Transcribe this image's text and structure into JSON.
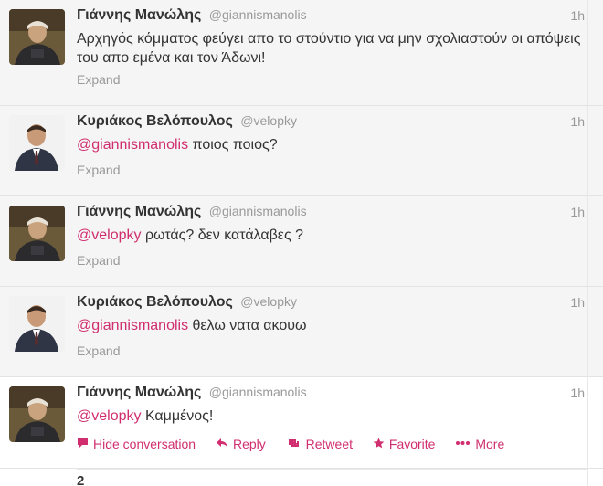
{
  "tweets": [
    {
      "fullname": "Γιάννης Μανώλης",
      "username": "@giannismanolis",
      "time": "1h",
      "text": "Αρχηγός κόμματος φεύγει απο το στούντιο για να μην σχολιαστούν οι απόψεις του απο εμένα και τον Άδωνι!",
      "expand": "Expand"
    },
    {
      "fullname": "Κυριάκος Βελόπουλος",
      "username": "@velopky",
      "time": "1h",
      "mention": "@giannismanolis",
      "text": " ποιος ποιος?",
      "expand": "Expand"
    },
    {
      "fullname": "Γιάννης Μανώλης",
      "username": "@giannismanolis",
      "time": "1h",
      "mention": "@velopky",
      "text": " ρωτάς? δεν κατάλαβες ?",
      "expand": "Expand"
    },
    {
      "fullname": "Κυριάκος Βελόπουλος",
      "username": "@velopky",
      "time": "1h",
      "mention": "@giannismanolis",
      "text": " θελω νατα ακουω",
      "expand": "Expand"
    },
    {
      "fullname": "Γιάννης Μανώλης",
      "username": "@giannismanolis",
      "time": "1h",
      "mention": "@velopky",
      "text": " Καμμένος!",
      "actions": {
        "hide": "Hide conversation",
        "reply": "Reply",
        "retweet": "Retweet",
        "favorite": "Favorite",
        "more": "More"
      }
    }
  ],
  "footer": {
    "count": "2"
  },
  "colors": {
    "link": "#d02e6f",
    "meta": "#999999",
    "background": "#f5f5f5"
  },
  "icons": [
    "speech-bubble-icon",
    "reply-arrow-icon",
    "retweet-icon",
    "star-icon",
    "ellipsis-icon"
  ]
}
